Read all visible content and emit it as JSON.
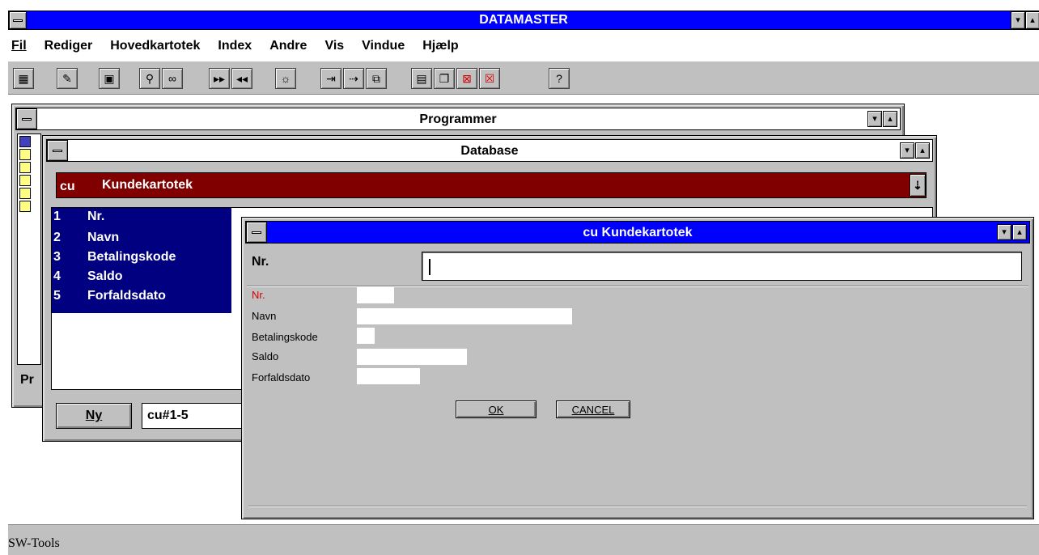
{
  "app": {
    "title": "DATAMASTER"
  },
  "menu": [
    "Fil",
    "Rediger",
    "Hovedkartotek",
    "Index",
    "Andre",
    "Vis",
    "Vindue",
    "Hjælp"
  ],
  "toolbar_icons": [
    "calculator-icon",
    "edit-icon",
    "save-icon",
    "search-icon",
    "view-icon",
    "fast-forward-icon",
    "rewind-icon",
    "lightbulb-icon",
    "insert-icon",
    "insert-record-icon",
    "copy-icon",
    "tile-icon",
    "cascade-icon",
    "delete-window-icon",
    "close-window-icon",
    "help-icon"
  ],
  "programmer": {
    "title": "Programmer",
    "footer_fragment": "Pr"
  },
  "database": {
    "title": "Database",
    "selector_code": "cu",
    "selector_name": "Kundekartotek",
    "fields": [
      {
        "num": "1",
        "name": "Nr."
      },
      {
        "num": "2",
        "name": "Navn"
      },
      {
        "num": "3",
        "name": "Betalingskode"
      },
      {
        "num": "4",
        "name": "Saldo"
      },
      {
        "num": "5",
        "name": "Forfaldsdato"
      }
    ],
    "new_button": "Ny",
    "range_value": "cu#1-5"
  },
  "dialog": {
    "title": "cu Kundekartotek",
    "key_label": "Nr.",
    "key_value": "",
    "form_fields": [
      {
        "label": "Nr.",
        "value": "",
        "color": "#d00000"
      },
      {
        "label": "Navn",
        "value": ""
      },
      {
        "label": "Betalingskode",
        "value": ""
      },
      {
        "label": "Saldo",
        "value": ""
      },
      {
        "label": "Forfaldsdato",
        "value": ""
      }
    ],
    "ok_label": "OK",
    "cancel_label": "CANCEL"
  },
  "status": {
    "text": "SW-Tools"
  },
  "colors": {
    "title_active": "#0000ff",
    "title_selected": "#0000a0",
    "selector_bg": "#800000",
    "list_bg": "#000080"
  }
}
